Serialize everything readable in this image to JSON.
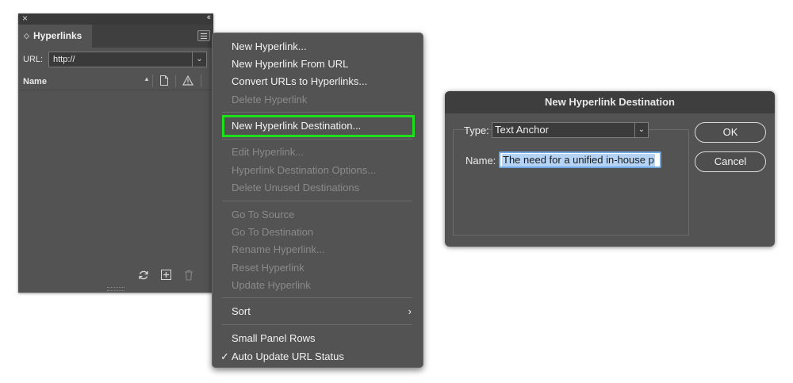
{
  "panel": {
    "tab_label": "Hyperlinks",
    "url_label": "URL:",
    "url_value": "http://",
    "column_name": "Name"
  },
  "menu": {
    "group1": [
      "New Hyperlink...",
      "New Hyperlink From URL",
      "Convert URLs to Hyperlinks...",
      "Delete Hyperlink"
    ],
    "group2": [
      "New Hyperlink Destination..."
    ],
    "group3": [
      "Edit Hyperlink...",
      "Hyperlink Destination Options...",
      "Delete Unused Destinations"
    ],
    "group4": [
      "Go To Source",
      "Go To Destination",
      "Rename Hyperlink...",
      "Reset Hyperlink",
      "Update Hyperlink"
    ],
    "group5": [
      "Sort"
    ],
    "group6": [
      "Small Panel Rows",
      "Auto Update URL Status"
    ],
    "highlight_color": "#1ee01a"
  },
  "dialog": {
    "title": "New Hyperlink Destination",
    "type_label": "Type:",
    "type_value": "Text Anchor",
    "name_label": "Name:",
    "name_value": "The need for a unified in-house p",
    "ok_label": "OK",
    "cancel_label": "Cancel"
  }
}
